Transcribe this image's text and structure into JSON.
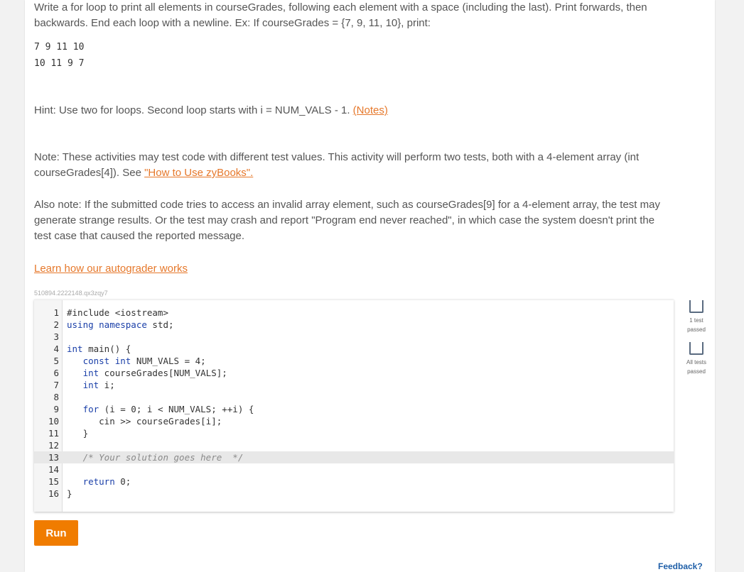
{
  "instructions": {
    "para1": "Write a for loop to print all elements in courseGrades, following each element with a space (including the last). Print forwards, then backwards. End each loop with a newline. Ex: If courseGrades = {7, 9, 11, 10}, print:",
    "example_line1": "7 9 11 10",
    "example_line2": "10 11 9 7",
    "hint": "Hint: Use two for loops. Second loop starts with i = NUM_VALS - 1.",
    "hint_link": "(Notes)",
    "note": "Note: These activities may test code with different test values. This activity will perform two tests, both with a 4-element array (int courseGrades[4]). See",
    "note_link": "\"How to Use zyBooks\".",
    "also_note": "Also note: If the submitted code tries to access an invalid array element, such as courseGrades[9] for a 4-element array, the test may generate strange results. Or the test may crash and report \"Program end never reached\", in which case the system doesn't print the test case that caused the reported message.",
    "learn_link": "Learn how our autograder works",
    "code_id": "510894.2222148.qx3zqy7"
  },
  "editor": {
    "lines": [
      {
        "n": "1",
        "html": "#include &lt;iostream&gt;"
      },
      {
        "n": "2",
        "html": "<span class='kw'>using namespace</span> std;"
      },
      {
        "n": "3",
        "html": ""
      },
      {
        "n": "4",
        "html": "<span class='kw'>int</span> main() {"
      },
      {
        "n": "5",
        "html": "   <span class='kw'>const int</span> NUM_VALS = 4;"
      },
      {
        "n": "6",
        "html": "   <span class='kw'>int</span> courseGrades[NUM_VALS];"
      },
      {
        "n": "7",
        "html": "   <span class='kw'>int</span> i;"
      },
      {
        "n": "8",
        "html": ""
      },
      {
        "n": "9",
        "html": "   <span class='kw'>for</span> (i = 0; i &lt; NUM_VALS; ++i) {"
      },
      {
        "n": "10",
        "html": "      cin &gt;&gt; courseGrades[i];"
      },
      {
        "n": "11",
        "html": "   }"
      },
      {
        "n": "12",
        "html": ""
      },
      {
        "n": "13",
        "html": "   <span class='cm'>/* Your solution goes here  */</span>"
      },
      {
        "n": "14",
        "html": ""
      },
      {
        "n": "15",
        "html": "   <span class='kw'>return</span> 0;"
      },
      {
        "n": "16",
        "html": "}"
      }
    ],
    "active_line": "13"
  },
  "run_button": "Run",
  "status": {
    "test1": "1 test passed",
    "all": "All tests passed"
  },
  "feedback_link": "Feedback?",
  "colors": {
    "accent": "#e6782b",
    "run_button": "#f07c00",
    "feedback": "#1f5fa8"
  }
}
